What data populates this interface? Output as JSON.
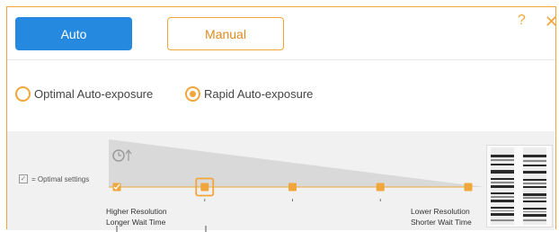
{
  "header": {
    "auto_label": "Auto",
    "manual_label": "Manual",
    "help_symbol": "?",
    "close_symbol": "✕"
  },
  "exposure": {
    "option1_label": "Optimal Auto-exposure",
    "option2_label": "Rapid Auto-exposure",
    "selected": "Rapid Auto-exposure"
  },
  "slider": {
    "legend_label": "= Optimal settings",
    "high_line1": "Higher Resolution",
    "high_line2": "Longer Wait Time",
    "low_line1": "Lower Resolution",
    "low_line2": "Shorter Wait Time",
    "positions": 5,
    "selected_index": 1,
    "optimal_index": 0
  },
  "icons": {
    "clock": "clock-arrow-icon",
    "help": "help-icon",
    "close": "close-icon",
    "gel": "gel-preview-image"
  },
  "colors": {
    "accent": "#f0a63a",
    "primary": "#2589e0",
    "panel": "#f1f1f1"
  }
}
